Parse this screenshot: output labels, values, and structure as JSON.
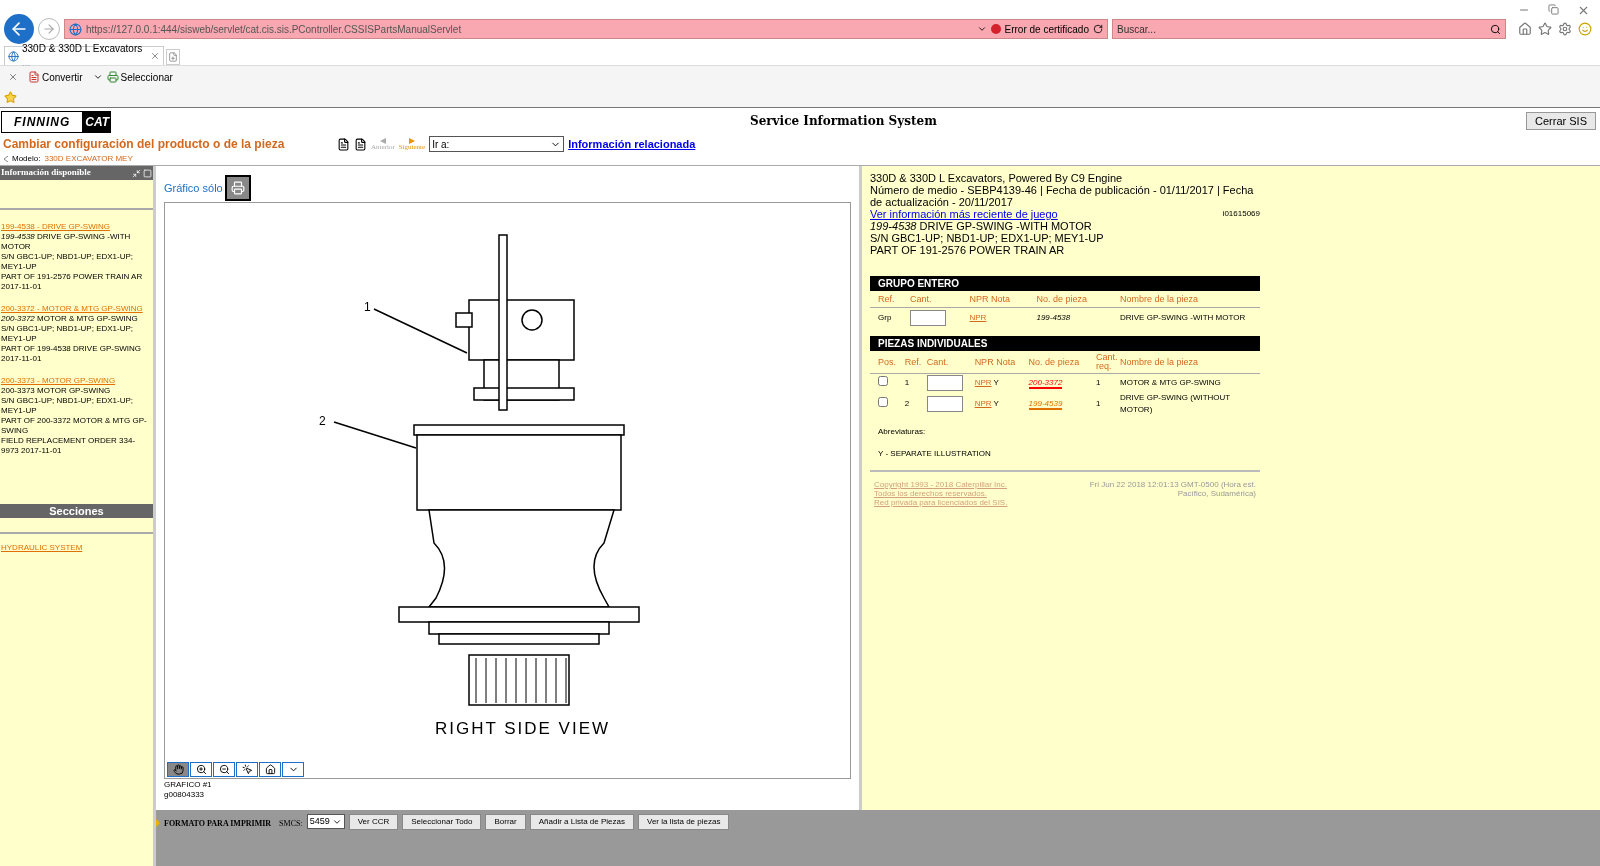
{
  "browser": {
    "address": "https://127.0.0.1:444/sisweb/servlet/cat.cis.sis.PController.CSSISPartsManualServlet",
    "cert_error": "Error de certificado",
    "search_placeholder": "Buscar...",
    "tab_title": "330D & 330D L Excavators ...",
    "commands": [
      "Convertir",
      "Seleccionar"
    ]
  },
  "header": {
    "brand": "FINNING",
    "brand_mark": "CAT",
    "title": "Service Information System",
    "close_button": "Cerrar SIS",
    "config_link": "Cambiar configuración del producto o de la pieza",
    "model_label": "Modelo:",
    "model_value": "330D EXCAVATOR MEY",
    "prev": "Anterior",
    "next": "Siguiente",
    "goto": "Ir a:",
    "related_link": "Información relacionada"
  },
  "sidebar": {
    "title": "Información disponible",
    "entries": [
      {
        "link": "199-4538 - DRIVE GP-SWING",
        "lines": [
          "*199-4538* DRIVE GP-SWING -WITH MOTOR",
          "S/N GBC1-UP; NBD1-UP; EDX1-UP; MEY1-UP",
          "PART OF 191-2576 POWER TRAIN AR 2017-11-01"
        ]
      },
      {
        "link": "200-3372 - MOTOR & MTG GP-SWING",
        "lines": [
          "*200-3372* MOTOR & MTG GP-SWING",
          "S/N GBC1-UP; NBD1-UP; EDX1-UP; MEY1-UP",
          "PART OF 199-4538 DRIVE GP-SWING 2017-11-01"
        ]
      },
      {
        "link": "200-3373 - MOTOR GP-SWING",
        "lines": [
          "200-3373 MOTOR GP-SWING",
          "S/N GBC1-UP; NBD1-UP; EDX1-UP; MEY1-UP",
          "PART OF 200-3372 MOTOR & MTG GP-SWING",
          "FIELD REPLACEMENT ORDER 334-9973 2017-11-01"
        ]
      }
    ],
    "sections_title": "Secciones",
    "sections": [
      "HYDRAULIC SYSTEM"
    ]
  },
  "graphic": {
    "graphic_only": "Gráfico sólo",
    "callouts": [
      "1",
      "2"
    ],
    "caption": "RIGHT SIDE VIEW",
    "label": "GRAFICO #1",
    "id": "g00804333"
  },
  "info": {
    "title": "330D & 330D L Excavators, Powered By C9 Engine",
    "media": "Número de medio - SEBP4139-46    |    Fecha de publicación - 01/11/2017    |    Fecha de actualización - 20/11/2017",
    "latest_link": "Ver información más reciente de juego",
    "doc_id": "i01615069",
    "part_lines": [
      "*199-4538* DRIVE GP-SWING -WITH MOTOR",
      "S/N GBC1-UP; NBD1-UP; EDX1-UP; MEY1-UP",
      "PART OF 191-2576 POWER TRAIN AR"
    ]
  },
  "group": {
    "title": "GRUPO ENTERO",
    "columns": [
      "Ref.",
      "Cant.",
      "NPR Nota",
      "No. de pieza",
      "Nombre de la pieza"
    ],
    "row": {
      "ref": "Grp",
      "npr": "NPR",
      "part_no": "199-4538",
      "name": "DRIVE GP-SWING -WITH MOTOR"
    }
  },
  "individual": {
    "title": "PIEZAS INDIVIDUALES",
    "columns": [
      "Pos.",
      "Ref.",
      "Cant.",
      "NPR Nota",
      "No. de pieza",
      "Cant. req.",
      "Nombre de la pieza"
    ],
    "rows": [
      {
        "checked": false,
        "ref": "1",
        "npr": "NPR",
        "note": "Y",
        "part_no": "200-3372",
        "color": "#ff0000",
        "qty": "1",
        "name": "MOTOR & MTG GP-SWING"
      },
      {
        "checked": false,
        "ref": "2",
        "npr": "NPR",
        "note": "Y",
        "part_no": "199-4539",
        "color": "#e07000",
        "qty": "1",
        "name": "DRIVE GP-SWING (WITHOUT MOTOR)"
      }
    ]
  },
  "abbreviations": {
    "title": "Abreviaturas:",
    "items": [
      "Y - SEPARATE ILLUSTRATION"
    ]
  },
  "footer": {
    "links": [
      "Copyright 1993 - 2018 Caterpillar Inc.",
      "Todos los derechos reservados.",
      "Red privada para licenciados del SIS."
    ],
    "timestamp": "Fri Jun 22 2018 12:01:13 GMT-0500 (Hora est. Pacífico, Sudamérica)"
  },
  "bottom_bar": {
    "print_label": "FORMATO PARA IMPRIMIR",
    "smcs_label": "SMCS:",
    "smcs_value": "5459",
    "buttons": [
      "Ver CCR",
      "Seleccionar Todo",
      "Borrar",
      "Añadir a Lista de Piezas",
      "Ver la lista de piezas"
    ]
  }
}
